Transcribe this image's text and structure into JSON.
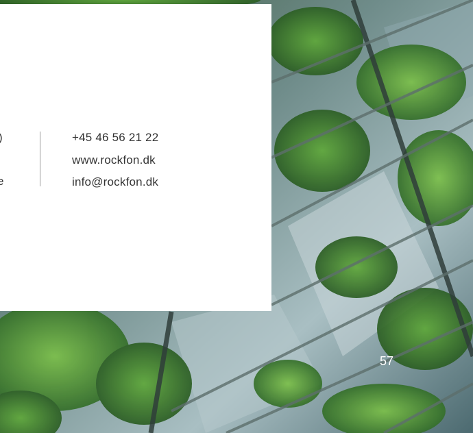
{
  "contact": {
    "phone": "+45 46 56 21 22",
    "website": "www.rockfon.dk",
    "email": "info@rockfon.dk"
  },
  "left_fragments": [
    ")",
    "e"
  ],
  "page_number": "57",
  "colors": {
    "panel": "#ffffff",
    "text": "#333333",
    "divider": "#9a9a9a",
    "page_number": "#ffffff"
  }
}
